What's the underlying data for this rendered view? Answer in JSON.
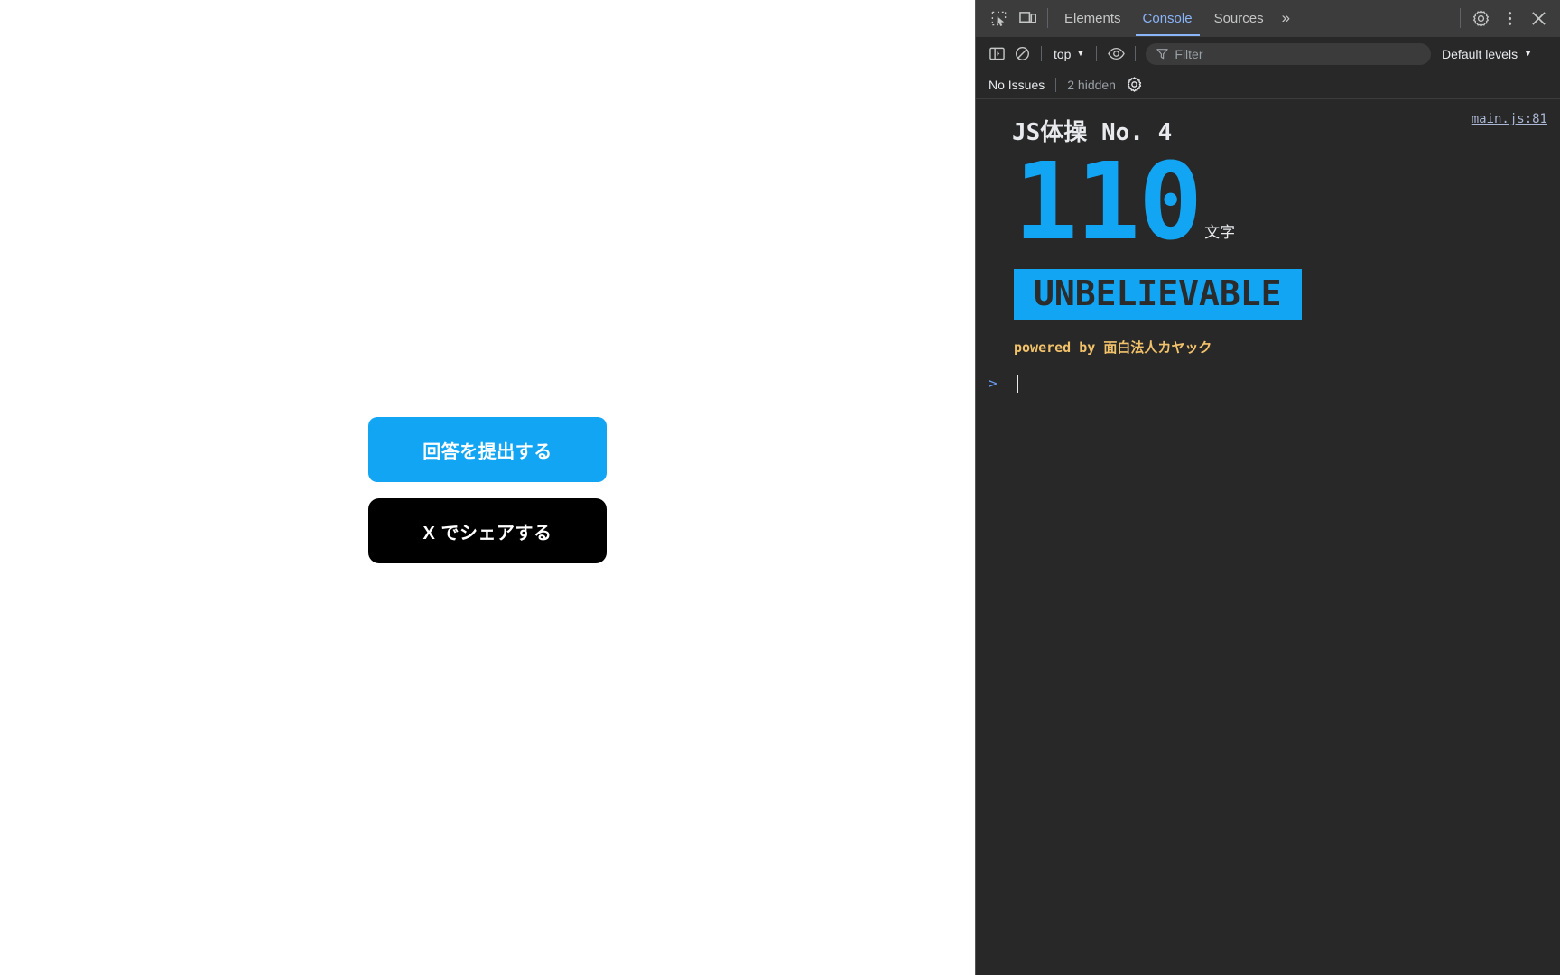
{
  "page": {
    "buttons": [
      {
        "label": "回答を提出する",
        "name": "submit-answer-button",
        "style": "primary"
      },
      {
        "label": "X でシェアする",
        "name": "share-on-x-button",
        "style": "dark"
      }
    ],
    "colors": {
      "primary": "#12a5f4",
      "dark": "#000000",
      "background": "#ffffff"
    }
  },
  "devtools": {
    "tabs": [
      {
        "label": "Elements",
        "active": false
      },
      {
        "label": "Console",
        "active": true
      },
      {
        "label": "Sources",
        "active": false
      }
    ],
    "more_tabs_glyph": "»",
    "toolbar": {
      "context_label": "top",
      "filter_placeholder": "Filter",
      "filter_value": "",
      "levels_label": "Default levels"
    },
    "issues_bar": {
      "issues_label": "No Issues",
      "hidden_label": "2 hidden"
    },
    "console": {
      "message": {
        "source_link": "main.js:81",
        "title": "JS体操 No. 4",
        "count": "110",
        "count_unit": "文字",
        "banner_text": "UNBELIEVABLE",
        "powered_by": "powered by 面白法人カヤック"
      },
      "prompt_chevron": ">",
      "prompt_value": ""
    },
    "colors": {
      "background": "#282828",
      "tabbar_background": "#3c3c3c",
      "accent_blue": "#8ab4f8",
      "highlight_blue": "#12a5f4",
      "orange": "#f2c26b",
      "text": "#e8eaed",
      "muted_text": "#9aa0a6",
      "link": "#a9b6d4"
    }
  }
}
